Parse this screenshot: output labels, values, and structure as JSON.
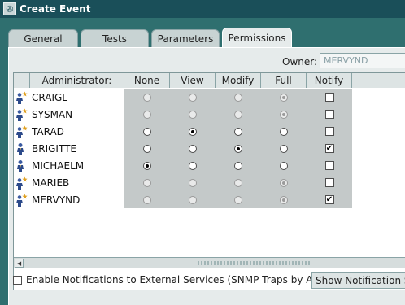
{
  "window": {
    "title": "Create Event",
    "app_icon_glyph": "✇"
  },
  "tabs": [
    {
      "label": "General"
    },
    {
      "label": "Tests"
    },
    {
      "label": "Parameters"
    },
    {
      "label": "Permissions"
    }
  ],
  "active_tab": "Permissions",
  "owner": {
    "label": "Owner:",
    "value": "MERVYND"
  },
  "grid": {
    "columns": [
      "Administrator:",
      "None",
      "View",
      "Modify",
      "Full",
      "Notify"
    ],
    "rows": [
      {
        "name": "CRAIGL",
        "icon": "admin-star-icon",
        "selected": "Full",
        "disabled": true,
        "notify": false
      },
      {
        "name": "SYSMAN",
        "icon": "admin-star-icon",
        "selected": "Full",
        "disabled": true,
        "notify": false
      },
      {
        "name": "TARAD",
        "icon": "admin-star-icon",
        "selected": "View",
        "disabled": false,
        "notify": false
      },
      {
        "name": "BRIGITTE",
        "icon": "user-icon",
        "selected": "Modify",
        "disabled": false,
        "notify": true
      },
      {
        "name": "MICHAELM",
        "icon": "user-icon",
        "selected": "None",
        "disabled": false,
        "notify": false
      },
      {
        "name": "MARIEB",
        "icon": "admin-star-icon",
        "selected": "Full",
        "disabled": true,
        "notify": false
      },
      {
        "name": "MERVYND",
        "icon": "admin-star-icon",
        "selected": "Full",
        "disabled": true,
        "notify": true
      }
    ]
  },
  "bottom": {
    "enable_notifications_label": "Enable Notifications to External Services (SNMP Traps by Agent)",
    "enable_notifications_checked": false,
    "show_button_label": "Show Notification Se"
  },
  "colors": {
    "window_bg": "#2f6f6f",
    "titlebar": "#1a4f59",
    "panel": "#e6ebeb",
    "permission_cells": "#c4c9c9"
  }
}
